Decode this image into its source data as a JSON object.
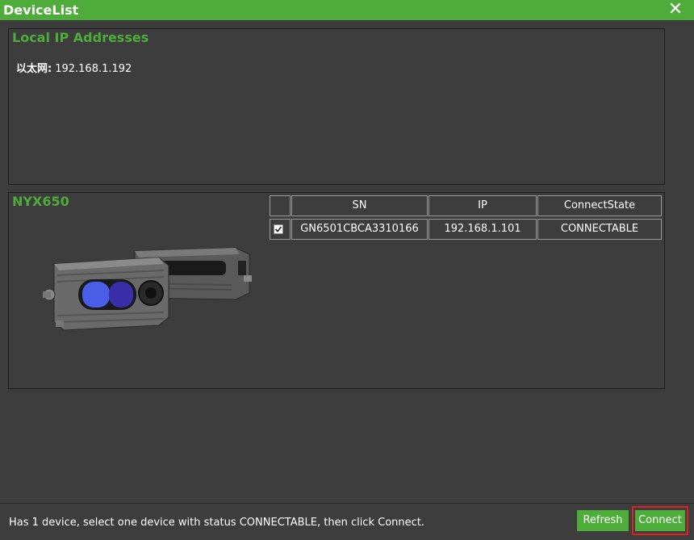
{
  "window": {
    "title": "DeviceList",
    "close_glyph": "✕"
  },
  "local_ip": {
    "title": "Local IP Addresses",
    "entries": [
      {
        "label": "以太网:",
        "value": "192.168.1.192"
      }
    ]
  },
  "device_panel": {
    "title": "NYX650",
    "image_icon": "depth-camera-image",
    "columns": [
      "",
      "SN",
      "IP",
      "ConnectState"
    ],
    "rows": [
      {
        "checked": true,
        "sn": "GN6501CBCA3310166",
        "ip": "192.168.1.101",
        "state": "CONNECTABLE"
      }
    ]
  },
  "status": {
    "message": "Has 1 device, select one device with status CONNECTABLE, then click Connect."
  },
  "buttons": {
    "refresh": "Refresh",
    "connect": "Connect"
  },
  "colors": {
    "accent": "#4ead3a",
    "background": "#3d3d3d",
    "highlight_border": "#e02020"
  }
}
